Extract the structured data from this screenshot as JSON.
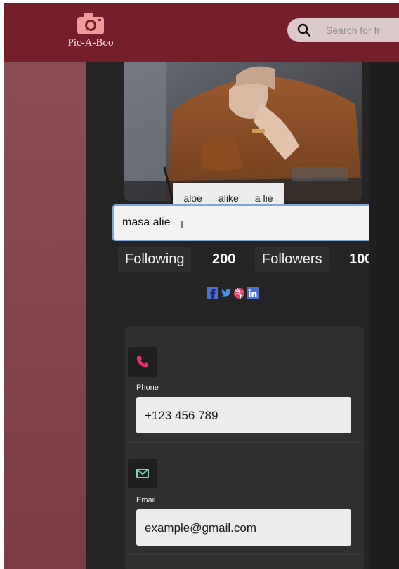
{
  "app": {
    "name": "Pic-A-Boo"
  },
  "search": {
    "placeholder": "Search for fri"
  },
  "profile": {
    "name_value": "masa alie",
    "suggestions": [
      "aloe",
      "alike",
      "a lie"
    ],
    "following_label": "Following",
    "following_count": "200",
    "followers_label": "Followers",
    "followers_count": "100",
    "social_icons": [
      "facebook-icon",
      "twitter-icon",
      "dribbble-icon",
      "linkedin-icon"
    ]
  },
  "contact": {
    "phone_label": "Phone",
    "phone_value": "+123 456 789",
    "email_label": "Email",
    "email_value": "example@gmail.com"
  },
  "colors": {
    "topbar": "#751f2a",
    "panel": "#242424",
    "phone_icon": "#e0346a",
    "email_icon": "#7fd6b0",
    "social": "#4f6fd0",
    "dribbble": "#e2425f"
  }
}
